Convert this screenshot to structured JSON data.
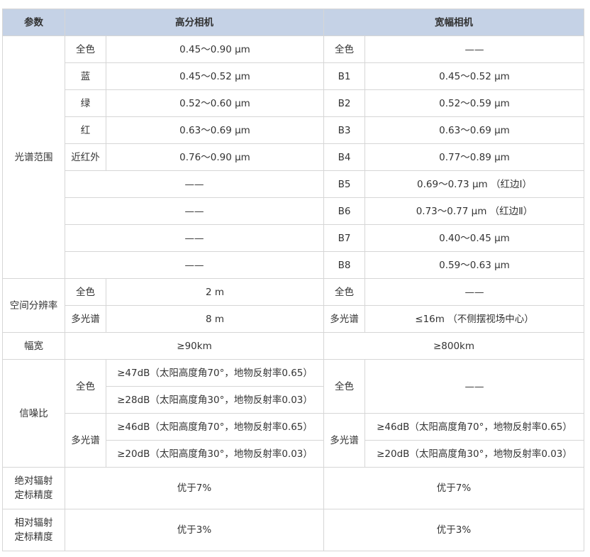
{
  "table": {
    "header": {
      "param": "参数",
      "high_res": "高分相机",
      "wide": "宽幅相机"
    },
    "spectral": {
      "label": "光谱范围",
      "rows": [
        {
          "hr_band": "全色",
          "hr_range": "0.45～0.90 μm",
          "w_band": "全色",
          "w_range": "——"
        },
        {
          "hr_band": "蓝",
          "hr_range": "0.45～0.52 μm",
          "w_band": "B1",
          "w_range": "0.45～0.52 μm"
        },
        {
          "hr_band": "绿",
          "hr_range": "0.52～0.60 μm",
          "w_band": "B2",
          "w_range": "0.52～0.59 μm"
        },
        {
          "hr_band": "红",
          "hr_range": "0.63～0.69 μm",
          "w_band": "B3",
          "w_range": "0.63～0.69 μm"
        },
        {
          "hr_band": "近红外",
          "hr_range": "0.76～0.90 μm",
          "w_band": "B4",
          "w_range": "0.77～0.89 μm"
        },
        {
          "hr_merged": "——",
          "w_band": "B5",
          "w_range": "0.69～0.73 μm （红边Ⅰ）"
        },
        {
          "hr_merged": "——",
          "w_band": "B6",
          "w_range": "0.73～0.77 μm （红边Ⅱ）"
        },
        {
          "hr_merged": "——",
          "w_band": "B7",
          "w_range": "0.40～0.45 μm"
        },
        {
          "hr_merged": "——",
          "w_band": "B8",
          "w_range": "0.59～0.63 μm"
        }
      ]
    },
    "spatial": {
      "label": "空间分辨率",
      "rows": [
        {
          "hr_band": "全色",
          "hr_value": "2 m",
          "w_band": "全色",
          "w_value": "——"
        },
        {
          "hr_band": "多光谱",
          "hr_value": "8 m",
          "w_band": "多光谱",
          "w_value": "≤16m （不侧摆视场中心）"
        }
      ]
    },
    "swath": {
      "label": "幅宽",
      "hr_value": "≥90km",
      "w_value": "≥800km"
    },
    "snr": {
      "label": "信噪比",
      "pan_label": "全色",
      "ms_label": "多光谱",
      "hr_pan": [
        "≥47dB（太阳高度角70°，地物反射率0.65）",
        "≥28dB（太阳高度角30°，地物反射率0.03）"
      ],
      "hr_ms": [
        "≥46dB（太阳高度角70°，地物反射率0.65）",
        "≥20dB（太阳高度角30°，地物反射率0.03）"
      ],
      "w_pan": "——",
      "w_ms": [
        "≥46dB（太阳高度角70°，地物反射率0.65）",
        "≥20dB（太阳高度角30°，地物反射率0.03）"
      ]
    },
    "abs_cal": {
      "label_line1": "绝对辐射",
      "label_line2": "定标精度",
      "hr_value": "优于7%",
      "w_value": "优于7%"
    },
    "rel_cal": {
      "label_line1": "相对辐射",
      "label_line2": "定标精度",
      "hr_value": "优于3%",
      "w_value": "优于3%"
    }
  }
}
